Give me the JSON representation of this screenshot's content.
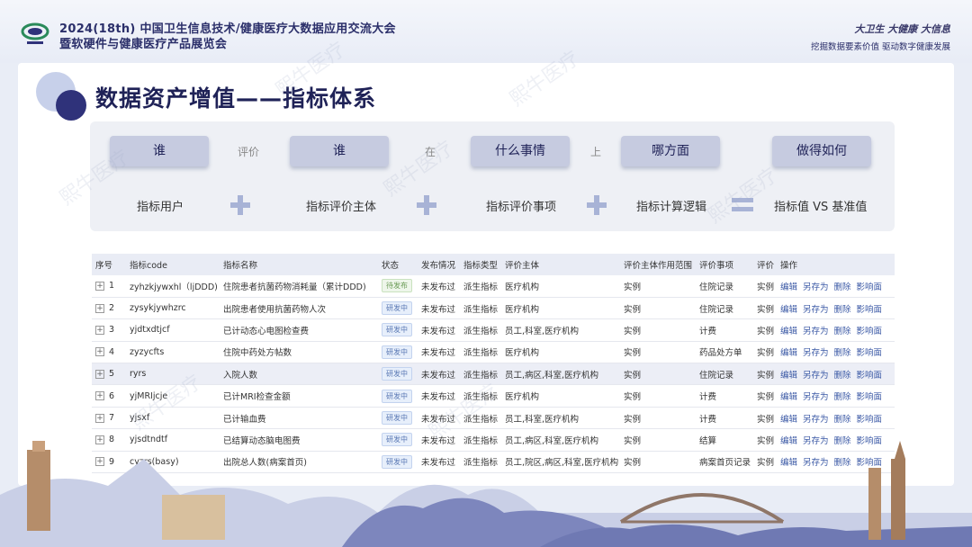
{
  "header": {
    "line1": "2024(18th) 中国卫生信息技术/健康医疗大数据应用交流大会",
    "line2": "暨软硬件与健康医疗产品展览会",
    "slogan": "大卫生 大健康 大信息",
    "tagline": "挖掘数据要素价值 驱动数字健康发展"
  },
  "page_title": "数据资产增值——指标体系",
  "formula": {
    "top": [
      "谁",
      "谁",
      "什么事情",
      "哪方面",
      "做得如何"
    ],
    "connectors": [
      "评价",
      "在",
      "上"
    ],
    "bottom": [
      "指标用户",
      "指标评价主体",
      "指标评价事项",
      "指标计算逻辑",
      "指标值 VS 基准值"
    ]
  },
  "watermark": "熙牛医疗",
  "table": {
    "columns": [
      "序号",
      "指标code",
      "指标名称",
      "状态",
      "发布情况",
      "指标类型",
      "评价主体",
      "评价主体作用范围",
      "评价事项",
      "评价",
      "操作"
    ],
    "ops": [
      "编辑",
      "另存为",
      "删除",
      "影响面"
    ],
    "rows": [
      {
        "no": "1",
        "code": "zyhzkjywxhl（ljDDD)",
        "name": "住院患者抗菌药物消耗量（累计DDD)",
        "status": "待发布",
        "pub": "未发布过",
        "type": "派生指标",
        "subject": "医疗机构",
        "scope": "实例",
        "item": "住院记录",
        "eval": "实例"
      },
      {
        "no": "2",
        "code": "zysykjywhzrc",
        "name": "出院患者使用抗菌药物人次",
        "status": "研发中",
        "pub": "未发布过",
        "type": "派生指标",
        "subject": "医疗机构",
        "scope": "实例",
        "item": "住院记录",
        "eval": "实例"
      },
      {
        "no": "3",
        "code": "yjdtxdtjcf",
        "name": "已计动态心电图检查费",
        "status": "研发中",
        "pub": "未发布过",
        "type": "派生指标",
        "subject": "员工,科室,医疗机构",
        "scope": "实例",
        "item": "计费",
        "eval": "实例"
      },
      {
        "no": "4",
        "code": "zyzycfts",
        "name": "住院中药处方帖数",
        "status": "研发中",
        "pub": "未发布过",
        "type": "派生指标",
        "subject": "医疗机构",
        "scope": "实例",
        "item": "药品处方单",
        "eval": "实例"
      },
      {
        "no": "5",
        "code": "ryrs",
        "name": "入院人数",
        "status": "研发中",
        "pub": "未发布过",
        "type": "派生指标",
        "subject": "员工,病区,科室,医疗机构",
        "scope": "实例",
        "item": "住院记录",
        "eval": "实例"
      },
      {
        "no": "6",
        "code": "yjMRIjcje",
        "name": "已计MRI检查金额",
        "status": "研发中",
        "pub": "未发布过",
        "type": "派生指标",
        "subject": "医疗机构",
        "scope": "实例",
        "item": "计费",
        "eval": "实例"
      },
      {
        "no": "7",
        "code": "yjsxf",
        "name": "已计输血费",
        "status": "研发中",
        "pub": "未发布过",
        "type": "派生指标",
        "subject": "员工,科室,医疗机构",
        "scope": "实例",
        "item": "计费",
        "eval": "实例"
      },
      {
        "no": "8",
        "code": "yjsdtndtf",
        "name": "已结算动态脑电图费",
        "status": "研发中",
        "pub": "未发布过",
        "type": "派生指标",
        "subject": "员工,病区,科室,医疗机构",
        "scope": "实例",
        "item": "结算",
        "eval": "实例"
      },
      {
        "no": "9",
        "code": "cyzrs(basy)",
        "name": "出院总人数(病案首页)",
        "status": "研发中",
        "pub": "未发布过",
        "type": "派生指标",
        "subject": "员工,院区,病区,科室,医疗机构",
        "scope": "实例",
        "item": "病案首页记录",
        "eval": "实例"
      }
    ]
  },
  "colors": {
    "accent": "#2f327a",
    "pill": "#c6cbe0",
    "link": "#3c5aa6"
  }
}
